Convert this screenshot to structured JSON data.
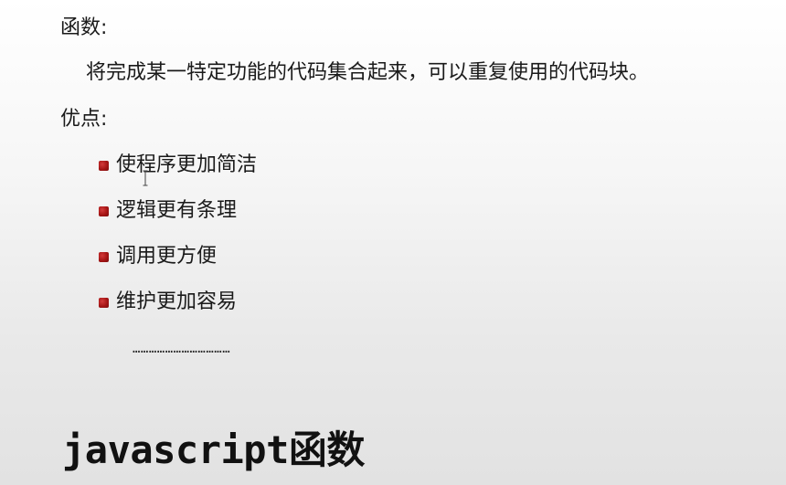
{
  "slide": {
    "heading_functions": "函数:",
    "definition": "将完成某一特定功能的代码集合起来，可以重复使用的代码块。",
    "heading_advantages": "优点:",
    "advantages": [
      "使程序更加简洁",
      "逻辑更有条理",
      "调用更方便",
      "维护更加容易"
    ],
    "ellipsis": "………………………………",
    "footer_title": "javascript函数"
  },
  "icons": {
    "bullet": "square-bullet-icon",
    "cursor": "text-cursor-icon"
  },
  "colors": {
    "bullet": "#a51515",
    "text": "#1a1a1a"
  }
}
